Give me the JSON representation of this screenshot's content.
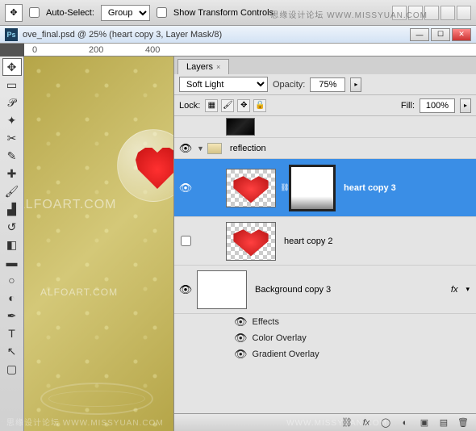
{
  "options": {
    "auto_select_label": "Auto-Select:",
    "auto_select_value": "Group",
    "show_transform_label": "Show Transform Controls"
  },
  "doc": {
    "title": "ove_final.psd @ 25% (heart copy 3, Layer Mask/8)",
    "ruler": [
      "0",
      "200",
      "400"
    ]
  },
  "canvas_watermarks": {
    "top": "ALFOART.COM",
    "mid": "ALFOART.COM"
  },
  "panel": {
    "tab": "Layers",
    "blend_mode": "Soft Light",
    "opacity_label": "Opacity:",
    "opacity_value": "75%",
    "lock_label": "Lock:",
    "fill_label": "Fill:",
    "fill_value": "100%"
  },
  "layers": {
    "group": "reflection",
    "selected": "heart copy 3",
    "item2": "heart copy 2",
    "item3": "Background copy 3",
    "effects": "Effects",
    "fx1": "Color Overlay",
    "fx2": "Gradient Overlay",
    "fx_symbol": "fx"
  },
  "watermarks": {
    "top": "思缘设计论坛   WWW.MISSYUAN.COM",
    "bottom_left": "思缘设计论坛   WWW.MISSYUAN.COM",
    "bottom_right": "WWW.MISSYUAN.COM"
  }
}
